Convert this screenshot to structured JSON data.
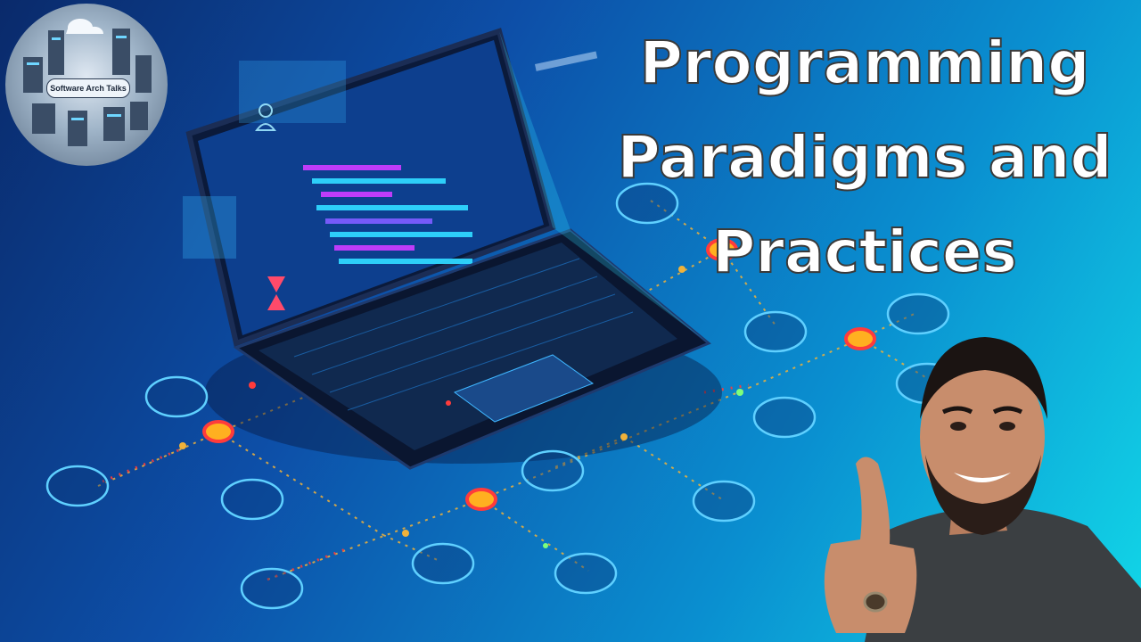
{
  "title": {
    "line1": "Programming",
    "line2": "Paradigms and",
    "line3": "Practices"
  },
  "logo": {
    "label": "Software Arch Talks"
  },
  "colors": {
    "bg_dark": "#0a2a6b",
    "bg_light": "#12d8e8",
    "node_red": "#ff3b3b",
    "node_orange": "#ffb020",
    "connector": "#f0b23a"
  }
}
